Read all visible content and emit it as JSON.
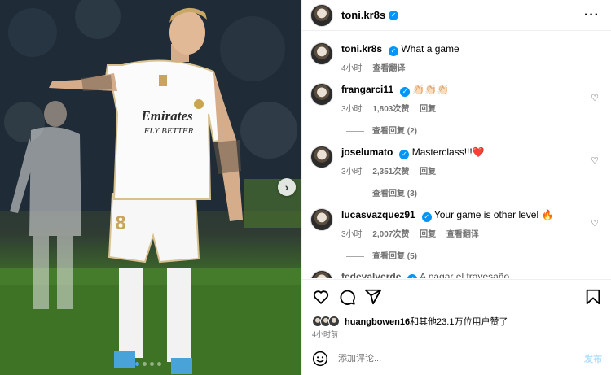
{
  "post": {
    "author": "toni.kr8s",
    "photo_alt": "Player in white kit pointing on pitch",
    "carousel_dots": 4,
    "carousel_active": 0
  },
  "shirt": {
    "sponsor_line1": "Emirates",
    "sponsor_line2": "FLY BETTER",
    "number": "8"
  },
  "caption": {
    "username": "toni.kr8s",
    "text": "What a game",
    "time": "4小时",
    "translate": "查看翻译"
  },
  "comments": [
    {
      "username": "frangarci11",
      "text": "👏🏻👏🏻👏🏻",
      "time": "3小时",
      "likes": "1,803次赞",
      "reply": "回复",
      "view_replies": "查看回复 (2)"
    },
    {
      "username": "joselumato",
      "text": "Masterclass!!!❤️",
      "time": "3小时",
      "likes": "2,351次赞",
      "reply": "回复",
      "view_replies": "查看回复 (3)"
    },
    {
      "username": "lucasvazquez91",
      "text": "Your game is other level 🔥",
      "time": "3小时",
      "likes": "2,007次赞",
      "reply": "回复",
      "translate": "查看翻译",
      "view_replies": "查看回复 (5)"
    },
    {
      "username": "fedevalverde",
      "text": "A pagar el travesaño"
    }
  ],
  "likes_line": {
    "user": "huangbowen16",
    "rest": "和其他23.1万位用户赞了"
  },
  "post_time": "4小时前",
  "comment_box": {
    "placeholder": "添加评论...",
    "post_label": "发布"
  },
  "icons": {
    "more": "more-icon",
    "like": "heart-icon",
    "comment": "comment-icon",
    "share": "share-icon",
    "save": "bookmark-icon",
    "emoji": "emoji-icon",
    "next": "chevron-right-icon"
  },
  "colors": {
    "verified": "#0095f6",
    "muted": "#737373",
    "post_button": "#b2dffc"
  }
}
